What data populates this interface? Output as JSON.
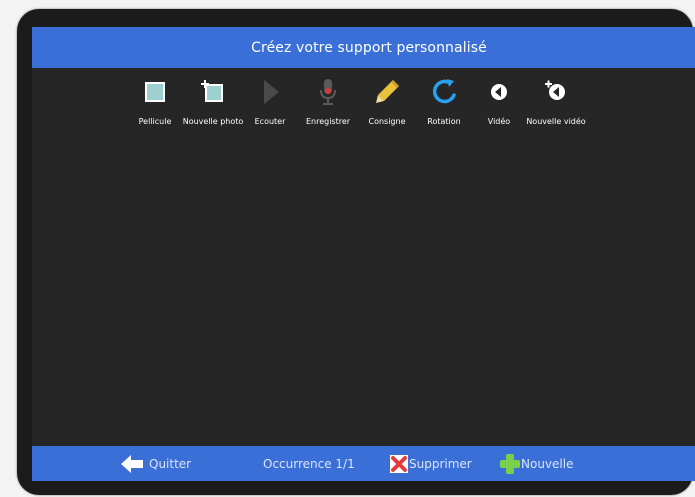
{
  "header": {
    "title": "Créez votre support personnalisé"
  },
  "toolbar": {
    "items": [
      {
        "label": "Pellicule",
        "icon": "film-frame-icon"
      },
      {
        "label": "Nouvelle photo",
        "icon": "new-photo-icon"
      },
      {
        "label": "Ecouter",
        "icon": "play-icon"
      },
      {
        "label": "Enregistrer",
        "icon": "microphone-icon"
      },
      {
        "label": "Consigne",
        "icon": "pencil-icon"
      },
      {
        "label": "Rotation",
        "icon": "rotate-icon"
      },
      {
        "label": "Vidéo",
        "icon": "video-icon"
      },
      {
        "label": "Nouvelle vidéo",
        "icon": "new-video-icon"
      }
    ]
  },
  "footer": {
    "quit_label": "Quitter",
    "occurrence_label": "Occurrence 1/1",
    "delete_label": "Supprimer",
    "new_label": "Nouvelle"
  },
  "colors": {
    "accent_bar": "#3a6fd8",
    "device_frame": "#1b1b1b",
    "canvas": "#262626",
    "icon_tile": "#9fd0d0",
    "delete_red": "#e63b3b",
    "new_green": "#7ad04a"
  }
}
